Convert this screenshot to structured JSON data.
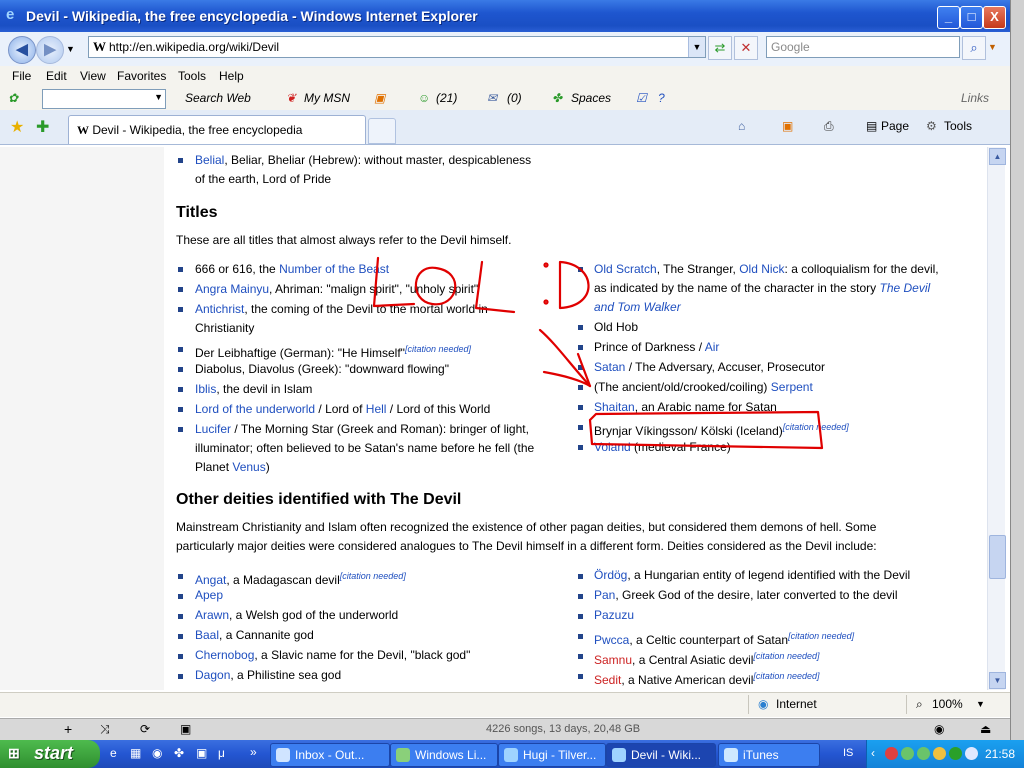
{
  "window": {
    "title": "Devil - Wikipedia, the free encyclopedia - Windows Internet Explorer",
    "minimize": "_",
    "maximize": "□",
    "close": "X"
  },
  "address": {
    "url": "http://en.wikipedia.org/wiki/Devil",
    "search_placeholder": "Google"
  },
  "menu": [
    "File",
    "Edit",
    "View",
    "Favorites",
    "Tools",
    "Help"
  ],
  "msn_toolbar": {
    "search_web": "Search Web",
    "my_msn": "My MSN",
    "contacts": "(21)",
    "mail": "(0)",
    "spaces": "Spaces",
    "links": "Links"
  },
  "tabs": {
    "active": "Devil - Wikipedia, the free encyclopedia",
    "page": "Page",
    "tools": "Tools"
  },
  "page": {
    "top_items": [
      {
        "link": "Belial",
        "rest": ", Beliar, Bheliar (Hebrew): without master, despicableness",
        "line2": "of the earth, Lord of Pride"
      }
    ],
    "titles_heading": "Titles",
    "titles_intro": "These are all titles that almost always refer to the Devil himself.",
    "left_titles": [
      {
        "pre": "666 or 616, the ",
        "link": "Number of the Beast",
        "post": ""
      },
      {
        "pre": "",
        "link": "Angra Mainyu",
        "post": ", Ahriman: \"malign spirit\", \"unholy spirit\""
      },
      {
        "pre": "",
        "link": "Antichrist",
        "post": ", the coming of the Devil to the mortal world in",
        "line2": "Christianity"
      },
      {
        "pre": "Der Leibhaftige (German): \"He Himself\"",
        "link": "",
        "post": "",
        "cite": "[citation needed]"
      },
      {
        "pre": "Diabolus, Diavolus (Greek): \"downward flowing\"",
        "link": "",
        "post": ""
      },
      {
        "pre": "",
        "link": "Iblis",
        "post": ", the devil in Islam"
      },
      {
        "pre": "",
        "link": "Lord of the underworld",
        "post": " / Lord of ",
        "link2": "Hell",
        "post2": " / Lord of this World"
      },
      {
        "pre": "",
        "link": "Lucifer",
        "post": " / The Morning Star (Greek and Roman): bringer of light,",
        "line2": "illuminator; often believed to be Satan's name before he fell (the",
        "line3pre": "Planet ",
        "line3link": "Venus",
        "line3post": ")"
      }
    ],
    "right_titles": [
      {
        "link": "Old Scratch",
        "post": ", The Stranger, ",
        "link2": "Old Nick",
        "post2": ": a colloquialism for the devil,",
        "line2pre": "as indicated by the name of the character in the story ",
        "line2link": "The Devil",
        "line3link": "and Tom Walker"
      },
      {
        "text": "Old Hob"
      },
      {
        "pre": "Prince of Darkness / ",
        "link": "Air"
      },
      {
        "link": "Satan",
        "post": " / The Adversary, Accuser, Prosecutor"
      },
      {
        "pre": "(The ancient/old/crooked/coiling) ",
        "link": "Serpent"
      },
      {
        "link": "Shaitan",
        "post": ", an Arabic name for Satan"
      },
      {
        "pre": "Brynjar Víkingsson/ Kölski (Iceland)",
        "cite": "[citation needed]"
      },
      {
        "link": "Voland",
        "post": " (medieval France)"
      }
    ],
    "deities_heading": "Other deities identified with The Devil",
    "deities_intro_1": "Mainstream Christianity and Islam often recognized the existence of other pagan deities, but considered them demons of hell. Some",
    "deities_intro_2": "particularly major deities were considered analogues to The Devil himself in a different form. Deities considered as the Devil include:",
    "left_deities": [
      {
        "link": "Angat",
        "post": ", a Madagascan devil",
        "cite": "[citation needed]"
      },
      {
        "link": "Apep",
        "post": ""
      },
      {
        "link": "Arawn",
        "post": ", a Welsh god of the underworld"
      },
      {
        "link": "Baal",
        "post": ", a Cannanite god"
      },
      {
        "link": "Chernobog",
        "post": ", a Slavic name for the Devil, \"black god\""
      },
      {
        "link": "Dagon",
        "post": ", a Philistine sea god"
      }
    ],
    "right_deities": [
      {
        "link": "Ördög",
        "post": ", a Hungarian entity of legend identified with the Devil"
      },
      {
        "link": "Pan",
        "post": ", Greek God of the desire, later converted to the devil"
      },
      {
        "link": "Pazuzu",
        "post": ""
      },
      {
        "link": "Pwcca",
        "post": ", a Celtic counterpart of Satan",
        "cite": "[citation needed]"
      },
      {
        "link": "Samnu",
        "post": ", a Central Asiatic devil",
        "cite": "[citation needed]",
        "red": true
      },
      {
        "link": "Sedit",
        "post": ", a Native American devil",
        "cite": "[citation needed]",
        "red": true
      }
    ]
  },
  "annotation": {
    "scrawl": "LOL :D"
  },
  "status": {
    "zone": "Internet",
    "zoom": "100%"
  },
  "itunes": {
    "info": "4226 songs, 13 days, 20,48 GB"
  },
  "taskbar": {
    "start": "start",
    "tasks": [
      "Inbox - Out...",
      "Windows Li...",
      "Hugi - Tilver...",
      "Devil - Wiki...",
      "iTunes"
    ],
    "lang": "IS",
    "clock": "21:58"
  },
  "colors": {
    "link": "#1f4fbf",
    "redlink": "#cc2222",
    "annotation": "#e00000"
  }
}
